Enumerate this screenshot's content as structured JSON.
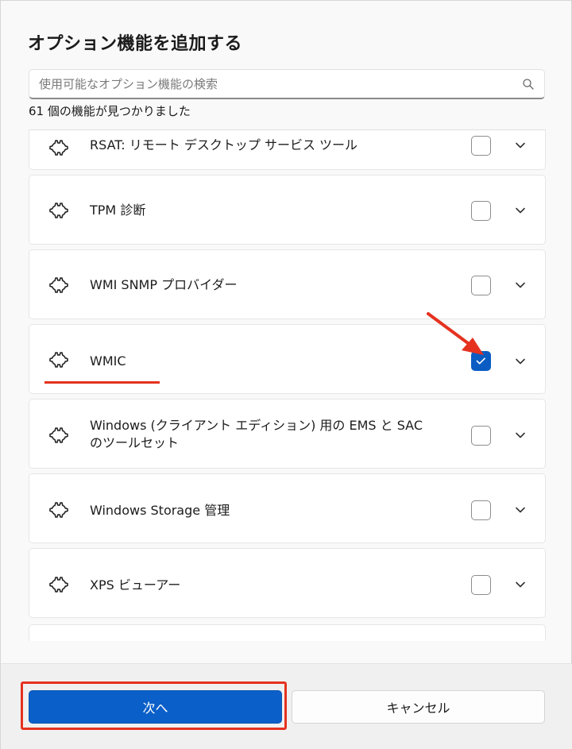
{
  "dialog": {
    "title": "オプション機能を追加する",
    "search_placeholder": "使用可能なオプション機能の検索",
    "result_count": "61 個の機能が見つかりました"
  },
  "features": [
    {
      "label": "RSAT: リモート デスクトップ サービス ツール",
      "checked": false
    },
    {
      "label": "TPM 診断",
      "checked": false
    },
    {
      "label": "WMI SNMP プロバイダー",
      "checked": false
    },
    {
      "label": "WMIC",
      "checked": true
    },
    {
      "label": "Windows (クライアント エディション) 用の EMS と SAC のツールセット",
      "checked": false
    },
    {
      "label": "Windows Storage 管理",
      "checked": false
    },
    {
      "label": "XPS ビューアー",
      "checked": false
    }
  ],
  "footer": {
    "next_label": "次へ",
    "cancel_label": "キャンセル"
  },
  "colors": {
    "accent": "#0b5fc8",
    "annotation": "#e5321f"
  },
  "icons": {
    "feature": "puzzle-gear-icon",
    "search": "search-icon",
    "expand": "chevron-down-icon",
    "check": "checkmark-icon",
    "annotation": "arrow-icon"
  }
}
